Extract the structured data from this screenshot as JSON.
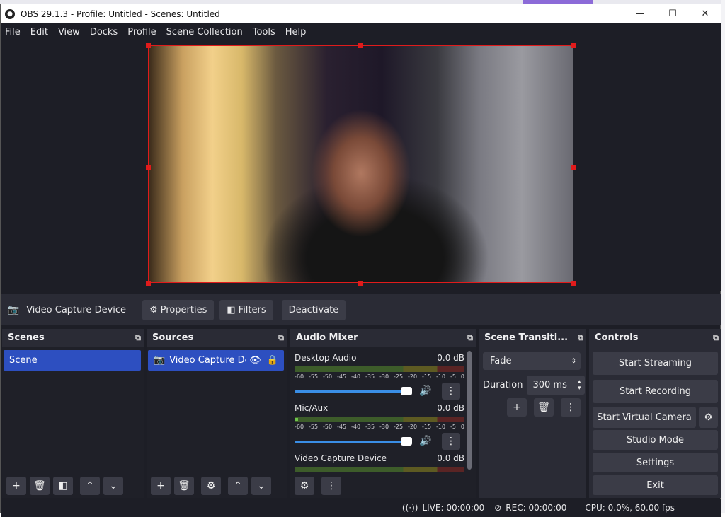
{
  "window": {
    "title": "OBS 29.1.3 - Profile: Untitled - Scenes: Untitled",
    "min": "—",
    "max": "☐",
    "close": "✕",
    "logo": "obs-logo"
  },
  "menu": [
    "File",
    "Edit",
    "View",
    "Docks",
    "Profile",
    "Scene Collection",
    "Tools",
    "Help"
  ],
  "source_toolbar": {
    "current_source": "Video Capture Device",
    "properties": "Properties",
    "filters": "Filters",
    "deactivate": "Deactivate"
  },
  "scenes": {
    "title": "Scenes",
    "items": [
      "Scene"
    ]
  },
  "sources": {
    "title": "Sources",
    "items": [
      "Video Capture Dev"
    ]
  },
  "mixer": {
    "title": "Audio Mixer",
    "channels": [
      {
        "name": "Desktop Audio",
        "db": "0.0 dB",
        "level": 0.0
      },
      {
        "name": "Mic/Aux",
        "db": "0.0 dB",
        "level": 0.02
      },
      {
        "name": "Video Capture Device",
        "db": "0.0 dB",
        "level": 0.0
      }
    ],
    "scale": [
      "-60",
      "-55",
      "-50",
      "-45",
      "-40",
      "-35",
      "-30",
      "-25",
      "-20",
      "-15",
      "-10",
      "-5",
      "0"
    ]
  },
  "transitions": {
    "title": "Scene Transiti...",
    "selected": "Fade",
    "duration_label": "Duration",
    "duration_value": "300 ms"
  },
  "controls": {
    "title": "Controls",
    "start_streaming": "Start Streaming",
    "start_recording": "Start Recording",
    "start_virtual_camera": "Start Virtual Camera",
    "studio_mode": "Studio Mode",
    "settings": "Settings",
    "exit": "Exit"
  },
  "status": {
    "live": "LIVE: 00:00:00",
    "rec": "REC: 00:00:00",
    "cpu": "CPU: 0.0%, 60.00 fps"
  },
  "colors": {
    "accent": "#2d4fc0",
    "selection_box": "#e01b1b",
    "bg": "#1d1e26",
    "panel": "#2a2b35"
  }
}
